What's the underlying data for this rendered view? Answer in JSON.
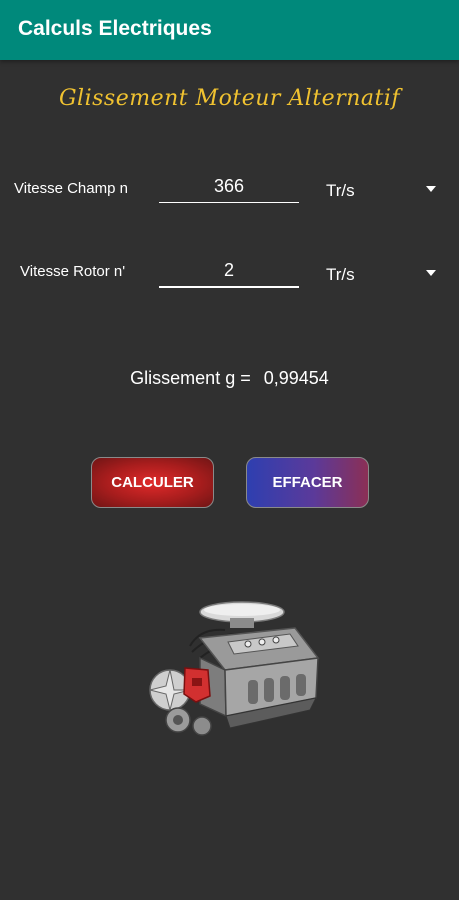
{
  "appbar": {
    "title": "Calculs Electriques"
  },
  "screen": {
    "title": "Glissement Moteur Alternatif"
  },
  "inputs": {
    "champ": {
      "label": "Vitesse Champ n",
      "value": "366",
      "unit": "Tr/s"
    },
    "rotor": {
      "label": "Vitesse Rotor n'",
      "value": "2",
      "unit": "Tr/s"
    }
  },
  "result": {
    "label": "Glissement g =",
    "value": "0,99454"
  },
  "buttons": {
    "calculate": "CALCULER",
    "clear": "EFFACER"
  },
  "icons": {
    "unit_dropdown": "triangle-down-icon",
    "illustration": "engine-illustration"
  },
  "colors": {
    "appbar": "#00897b",
    "background": "#303030",
    "title_accent": "#f0c230"
  }
}
